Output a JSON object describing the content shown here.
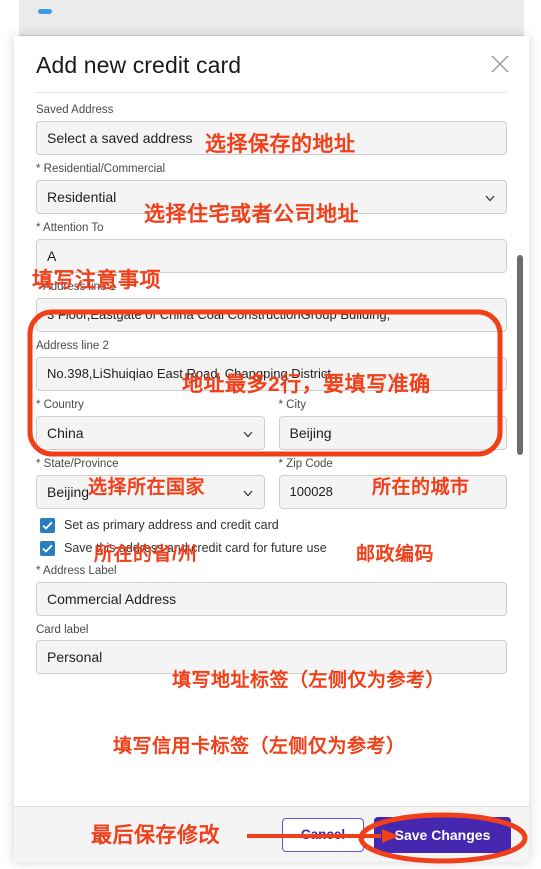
{
  "dialog": {
    "title": "Add new credit card",
    "close_icon": "close-icon"
  },
  "fields": {
    "saved_address": {
      "label": "Saved Address",
      "value": "Select a saved address",
      "annotation": "选择保存的地址"
    },
    "residential_commercial": {
      "label": "* Residential/Commercial",
      "value": "Residential",
      "annotation": "选择住宅或者公司地址"
    },
    "attention_to": {
      "label": "* Attention To",
      "value": "A",
      "annotation": "填写注意事项"
    },
    "address_line_1": {
      "label": "* Address line 1",
      "value": "3 Floor,Eastgate of China Coal ConstructionGroup Buliding,"
    },
    "address_line_2": {
      "label": "Address line 2",
      "value": "No.398,LiShuiqiao East Road, Changping District",
      "annotation": "地址最多2行，要填写准确"
    },
    "country": {
      "label": "* Country",
      "value": "China",
      "annotation": "选择所在国家"
    },
    "city": {
      "label": "* City",
      "value": "Beijing",
      "annotation": "所在的城市"
    },
    "state_province": {
      "label": "* State/Province",
      "value": "Beijing",
      "annotation": "所在的省/州"
    },
    "zip_code": {
      "label": "* Zip Code",
      "value": "100028",
      "annotation": "邮政编码"
    },
    "address_label": {
      "label": "* Address Label",
      "value": "Commercial Address",
      "annotation": "填写地址标签（左侧仅为参考）"
    },
    "card_label": {
      "label": "Card label",
      "value": "Personal",
      "annotation": "填写信用卡标签（左侧仅为参考）"
    }
  },
  "checkboxes": [
    {
      "label": "Set as primary address and credit card",
      "checked": true
    },
    {
      "label": "Save this address and credit card for future use",
      "checked": true
    }
  ],
  "footer": {
    "cancel_label": "Cancel",
    "save_label": "Save Changes",
    "annotation": "最后保存修改"
  },
  "colors": {
    "annotation_red": "#f0401a",
    "primary_purple": "#4527b0",
    "checkbox_blue": "#2b7ebc",
    "field_bg": "#f4f4f4",
    "field_border": "#cfcfcf"
  }
}
